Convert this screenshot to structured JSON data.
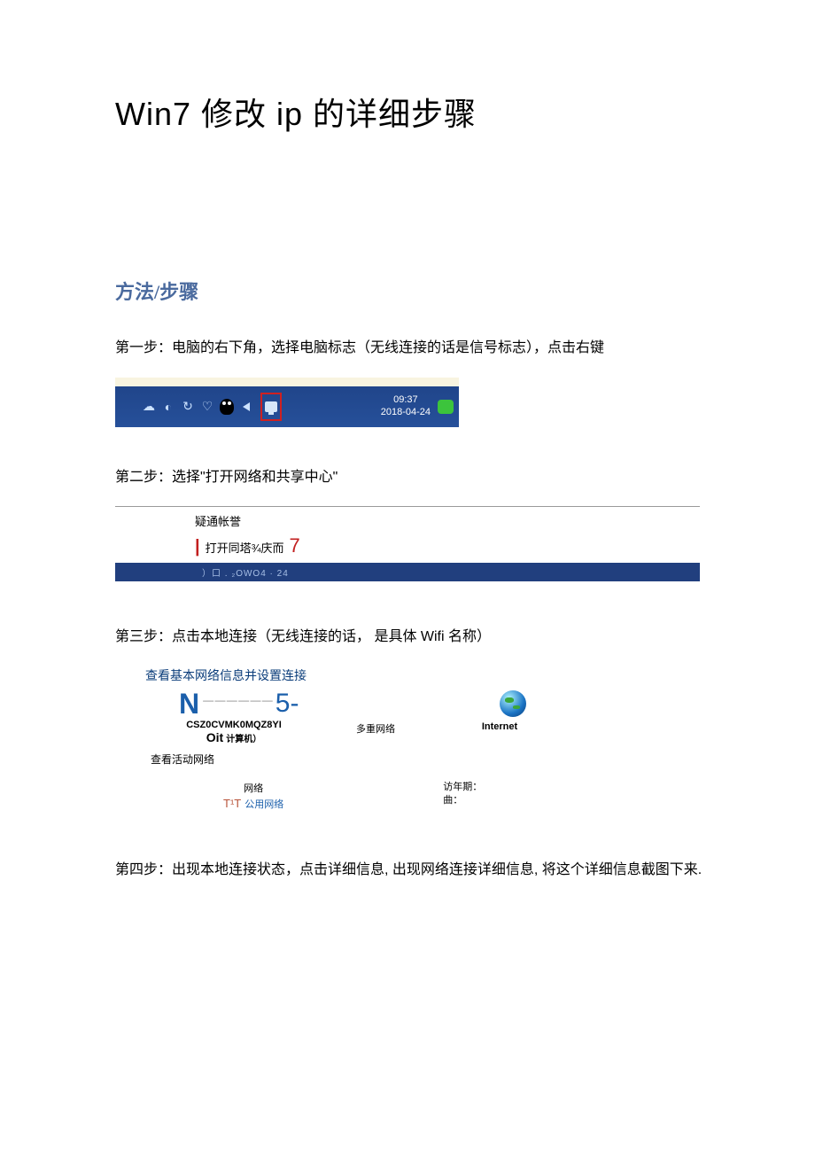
{
  "title": "Win7 修改 ip 的详细步骤",
  "section_heading": "方法/步骤",
  "step1": "第一步：电脑的右下角，选择电脑标志（无线连接的话是信号标志），点击右键",
  "taskbar": {
    "time": "09:37",
    "date": "2018-04-24"
  },
  "step2": "第二步：选择\"打开网络和共享中心\"",
  "contextmenu": {
    "item1": "疑通帐誉",
    "item2_mid": "打开同塔¾庆而",
    "item2_end": "7",
    "bluebar": "）口 . ₂OWO4 · 24"
  },
  "step3": "第三步：点击本地连接（无线连接的话， 是具体 Wifi 名称）",
  "netcenter": {
    "title": "查看基本网络信息并设置连接",
    "diagram": {
      "n": "N",
      "dashes": "— — — — — —",
      "five": "5-"
    },
    "computer_id": "CSZ0CVMK0MQZ8YI",
    "oit": "Oit",
    "oit_sub": "计算机）",
    "multinet": "多重网络",
    "internet": "Internet",
    "active_title": "查看活动网络",
    "net_label": "网络",
    "t1t": "T¹T",
    "public_net": "公用网络",
    "visit_period": "访年期：",
    "qu": "曲："
  },
  "step4": "第四步：出现本地连接状态，点击详细信息, 出现网络连接详细信息, 将这个详细信息截图下来."
}
